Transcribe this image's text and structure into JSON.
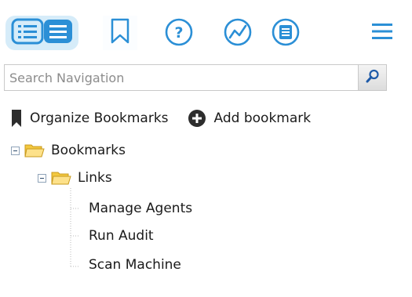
{
  "toolbar": {
    "buttons": [
      {
        "name": "tree-view",
        "icon": "list-tree-icon",
        "active": true
      },
      {
        "name": "bookmarks",
        "icon": "bookmark-icon",
        "active": false
      },
      {
        "name": "help",
        "icon": "help-circle-icon",
        "active": false
      },
      {
        "name": "trend",
        "icon": "trend-chart-icon",
        "active": false
      },
      {
        "name": "notes",
        "icon": "notes-icon",
        "active": false
      },
      {
        "name": "menu",
        "icon": "hamburger-menu-icon",
        "active": false
      }
    ],
    "accent_color": "#2b8fd6"
  },
  "search": {
    "placeholder": "Search Navigation",
    "value": ""
  },
  "actions": {
    "organize_label": "Organize Bookmarks",
    "add_label": "Add bookmark"
  },
  "tree": {
    "root": {
      "label": "Bookmarks",
      "expanded": true,
      "children": [
        {
          "label": "Links",
          "expanded": true,
          "children": [
            {
              "label": "Manage Agents"
            },
            {
              "label": "Run Audit"
            },
            {
              "label": "Scan Machine"
            }
          ]
        }
      ]
    }
  }
}
